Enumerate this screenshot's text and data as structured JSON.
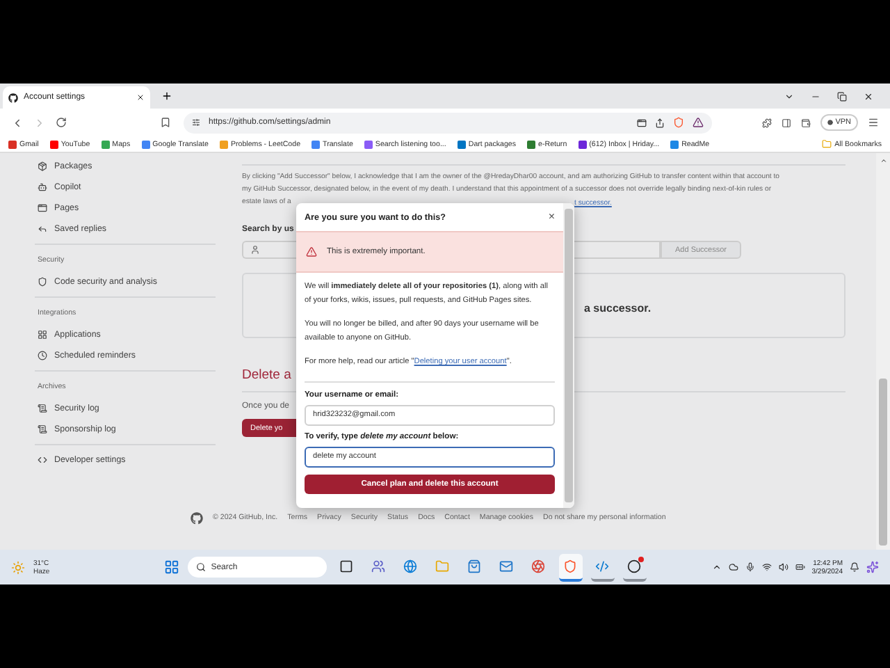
{
  "browser": {
    "tab": {
      "title": "Account settings",
      "selected": true
    },
    "url": "https://github.com/settings/admin",
    "forward_disabled": true,
    "vpn": "VPN",
    "bookmarks": [
      "Gmail",
      "YouTube",
      "Maps",
      "Google Translate",
      "Problems - LeetCode",
      "Translate",
      "Search listening too...",
      "Dart packages",
      "e-Return",
      "(612) Inbox | Hriday...",
      "ReadMe"
    ],
    "all_bookmarks": "All Bookmarks"
  },
  "sidebar": {
    "sections": [
      {
        "items": [
          "Packages",
          "Copilot",
          "Pages",
          "Saved replies"
        ]
      },
      {
        "heading": "Security",
        "items": [
          "Code security and analysis"
        ]
      },
      {
        "heading": "Integrations",
        "items": [
          "Applications",
          "Scheduled reminders"
        ]
      },
      {
        "heading": "Archives",
        "items": [
          "Security log",
          "Sponsorship log"
        ]
      },
      {
        "items": [
          "Developer settings"
        ]
      }
    ]
  },
  "main": {
    "consent_line_1": "By clicking \"Add Successor\" below, I acknowledge that I am the owner of the @HredayDhar00 account, and am authorizing GitHub to transfer content within that account to",
    "consent_line_2": "my GitHub Successor, designated below, in the event of my death. I understand that this appointment of a successor does not override legally binding next-of-kin rules or",
    "consent_line_3_left": "estate laws of a",
    "consent_line_3_right": "t successor.",
    "search_label": "Search by us",
    "add_button": "Add Successor",
    "successor_note": "a successor.",
    "delete_heading": "Delete a",
    "delete_note": "Once you de",
    "delete_button": "Delete yo"
  },
  "footer": {
    "copyright": "© 2024 GitHub, Inc.",
    "links": [
      "Terms",
      "Privacy",
      "Security",
      "Status",
      "Docs",
      "Contact",
      "Manage cookies",
      "Do not share my personal information"
    ]
  },
  "dialog": {
    "title": "Are you sure you want to do this?",
    "close": "×",
    "warning": "This is extremely important.",
    "paragraphs": [
      "We will **immediately delete all of your repositories (1)**, along with all of your forks, wikis, issues, pull requests, and GitHub Pages sites.",
      "You will no longer be billed, and after 90 days your username will be available to anyone on GitHub."
    ],
    "help_prefix": "For more help, read our article \"",
    "help_link": "Deleting your user account",
    "help_suffix": "\".",
    "username_label": "Your username or email:",
    "username_value": "hrid323232@gmail.com",
    "verify_label": "**To verify, type** *delete my account* **below:**",
    "verify_value": "delete my account",
    "verify_focused": true,
    "submit": "Cancel plan and delete this account"
  },
  "taskbar": {
    "temperature": "31°C",
    "weather": "Haze",
    "search_placeholder": "Search",
    "apps": [
      {
        "open": false,
        "selected": false
      },
      {
        "open": false,
        "selected": false
      },
      {
        "open": false,
        "selected": false
      },
      {
        "open": false,
        "selected": false
      },
      {
        "open": false,
        "selected": false
      },
      {
        "open": false,
        "selected": false
      },
      {
        "open": false,
        "selected": false
      },
      {
        "open": true,
        "selected": true
      },
      {
        "open": true,
        "selected": false
      },
      {
        "open": true,
        "selected": false
      }
    ],
    "time": "12:42 PM",
    "date": "3/29/2024"
  }
}
